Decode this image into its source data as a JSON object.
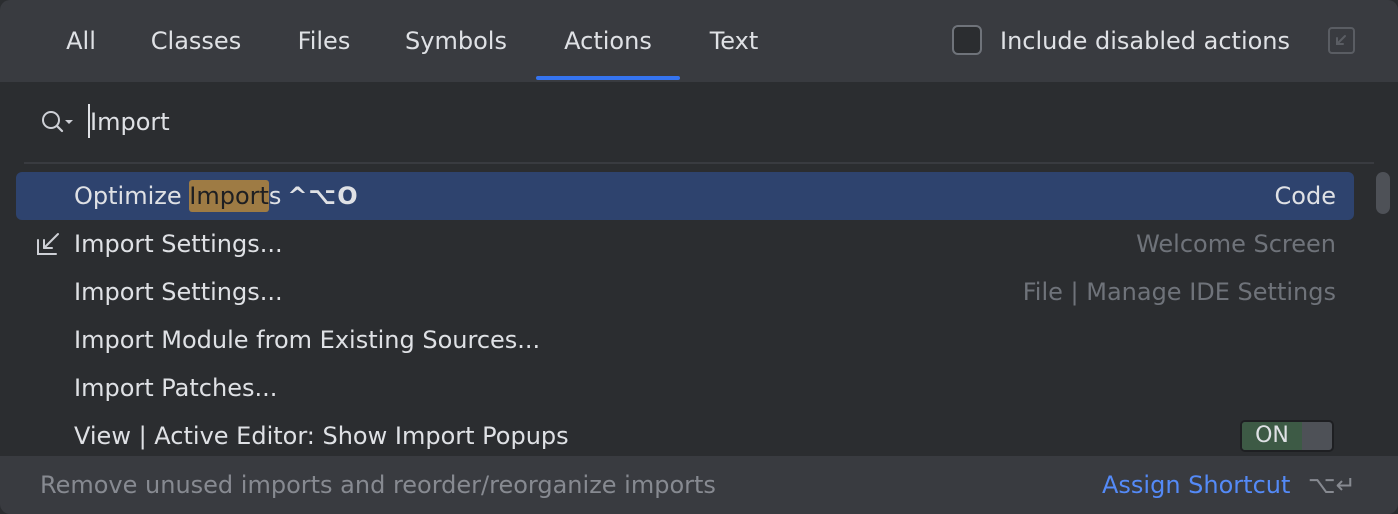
{
  "tabs": [
    {
      "label": "All"
    },
    {
      "label": "Classes"
    },
    {
      "label": "Files"
    },
    {
      "label": "Symbols"
    },
    {
      "label": "Actions",
      "active": true
    },
    {
      "label": "Text"
    }
  ],
  "options": {
    "include_disabled_label": "Include disabled actions",
    "include_disabled_checked": false
  },
  "search": {
    "value": "Import"
  },
  "results": [
    {
      "label_before": "Optimize ",
      "label_match": "Import",
      "label_after": "s",
      "shortcut": "^⌥O",
      "location": "Code",
      "selected": true
    },
    {
      "label": "Import Settings...",
      "location": "Welcome Screen",
      "icon": "import-arrow-icon"
    },
    {
      "label": "Import Settings...",
      "location": "File | Manage IDE Settings"
    },
    {
      "label": "Import Module from Existing Sources...",
      "location": ""
    },
    {
      "label": "Import Patches...",
      "location": ""
    },
    {
      "label": "View | Active Editor: Show Import Popups",
      "toggle": "ON"
    }
  ],
  "footer": {
    "description": "Remove unused imports and reorder/reorganize imports",
    "assign_shortcut": "Assign Shortcut",
    "keys": "⌥↵"
  },
  "colors": {
    "background": "#2b2d30",
    "header": "#393b40",
    "accent": "#3574f0",
    "selection": "#2e436e",
    "highlight": "#9e7b44",
    "link": "#548af7"
  }
}
